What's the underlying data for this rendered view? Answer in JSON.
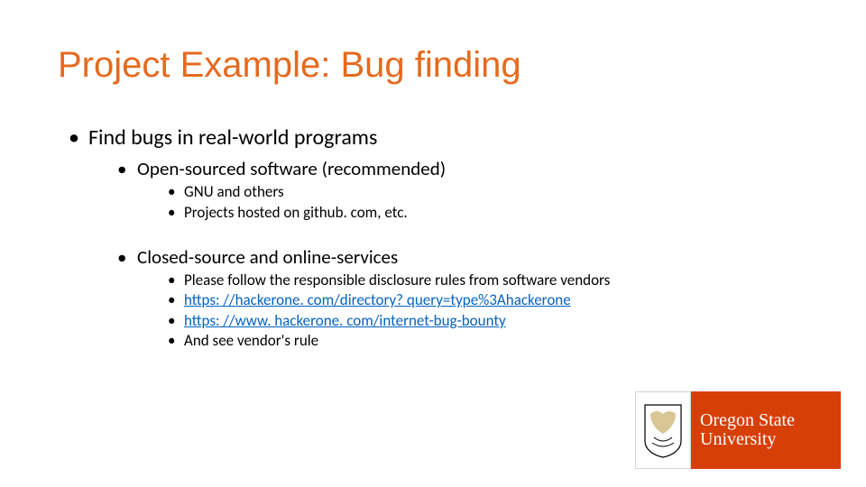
{
  "title": "Project Example: Bug finding",
  "bullets": {
    "l1": "Find bugs in real-world programs",
    "l2a": "Open-sourced software (recommended)",
    "l3a1": "GNU and others",
    "l3a2": "Projects hosted on github. com, etc.",
    "l2b": "Closed-source and online-services",
    "l3b1": "Please follow the responsible disclosure rules from software vendors",
    "l3b2": "https: //hackerone. com/directory? query=type%3Ahackerone",
    "l3b3": "https: //www. hackerone. com/internet-bug-bounty",
    "l3b4": "And see vendor's rule"
  },
  "logo": {
    "line1": "Oregon State",
    "line2": "University"
  }
}
